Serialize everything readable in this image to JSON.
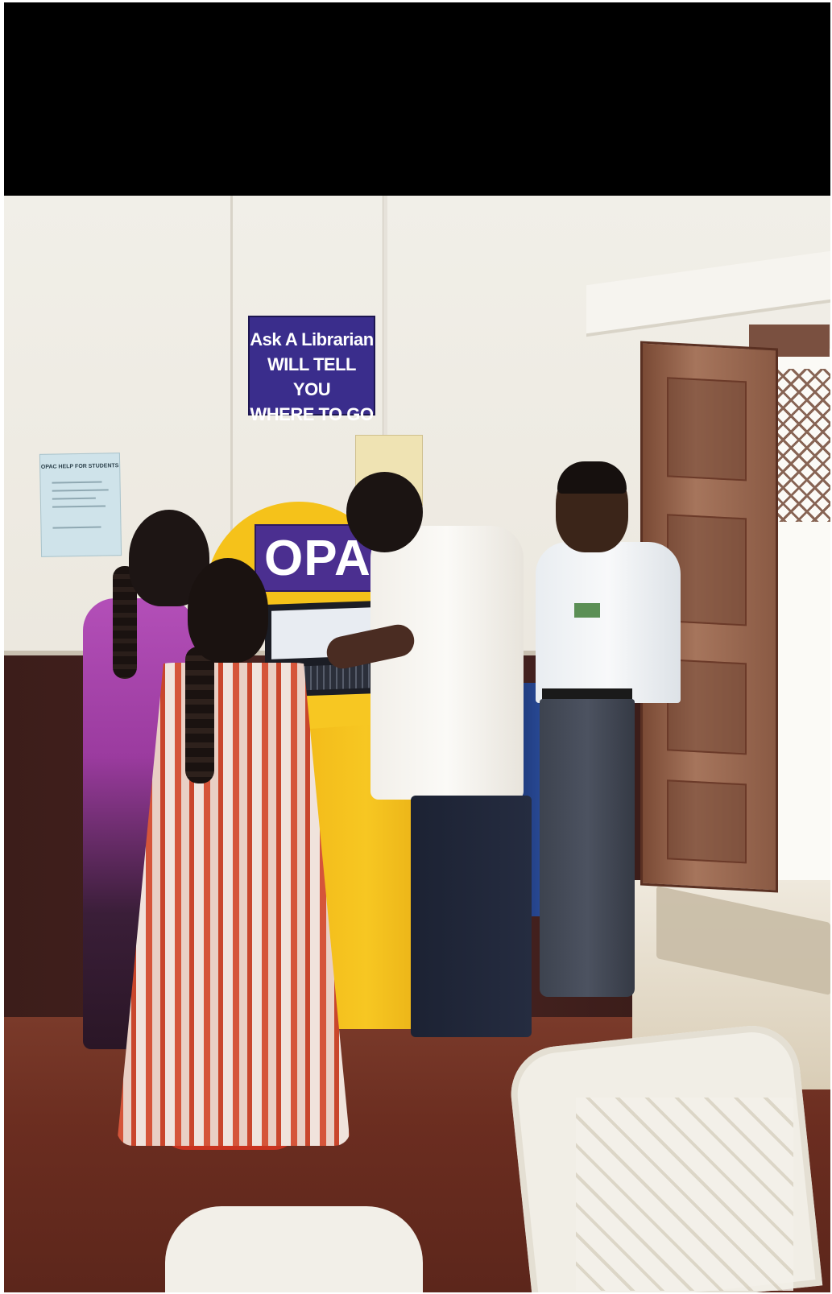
{
  "photo": {
    "wall_sign": {
      "lines": [
        "Ask A Librarian",
        "WILL TELL YOU",
        "WHERE TO GO"
      ],
      "colors": {
        "background": "#3a2d8c",
        "text": "#ffffff"
      }
    },
    "kiosk": {
      "label": "OPAC",
      "colors": {
        "body": "#f5c21a",
        "plate": "#4b2f90"
      }
    },
    "poster": {
      "title": "OPAC HELP FOR STUDENTS"
    }
  }
}
